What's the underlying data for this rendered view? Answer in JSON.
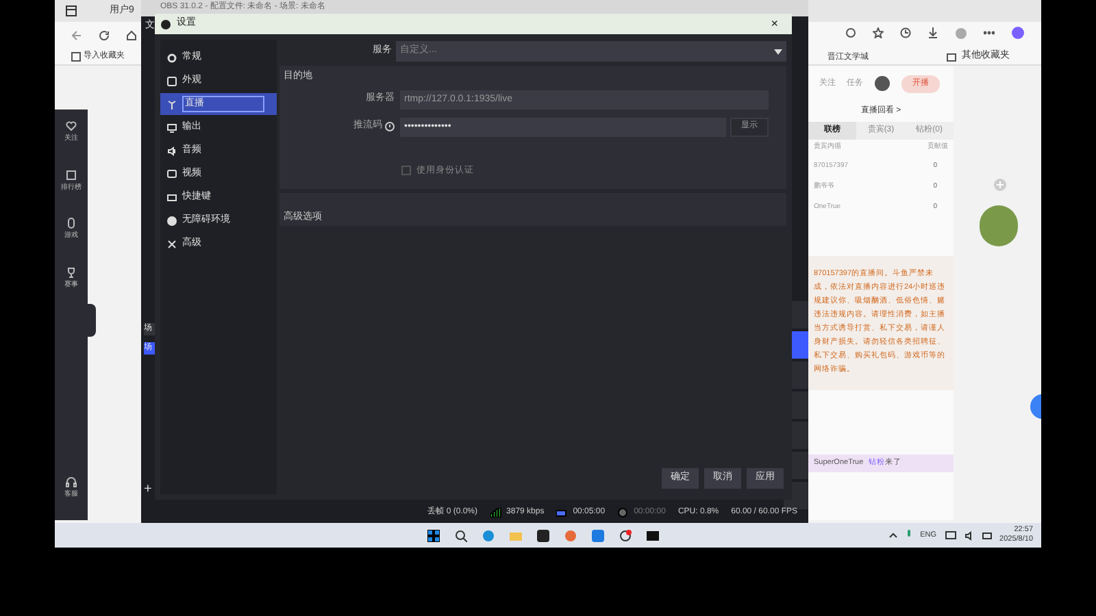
{
  "browser": {
    "tab_title": "用户9",
    "bookmarks": [
      "导入收藏夹",
      "晋江文学城",
      "其他收藏夹"
    ],
    "left_nav": [
      "关注",
      "排行榜",
      "游戏",
      "赛事",
      "客服"
    ],
    "header": {
      "follow": "关注",
      "task": "任务",
      "start_button": "开播",
      "replay": "直播回看 >"
    },
    "rank_tabs": [
      {
        "label": "联榜",
        "selected": true
      },
      {
        "label": "贵宾(3)",
        "selected": false
      },
      {
        "label": "钻粉(0)",
        "selected": false
      }
    ],
    "rank_head": {
      "name": "贵宾内循",
      "value": "贡献值"
    },
    "rank_rows": [
      {
        "name": "870157397",
        "value": "0"
      },
      {
        "name": "鹏爷爷",
        "value": "0"
      },
      {
        "name": "OneTrue",
        "value": "0"
      }
    ],
    "notice": "870157397的直播间。斗鱼严禁未成，依法对直播内容进行24小时巡违规建议你、吸烟酗酒、低俗色情、赌违法违规内容。请理性消费，如主播当方式诱导打赏、私下交易，请谨人身财产损失。请勿轻信各类招聘征、私下交易、购买礼包码、游戏币等的网络诈骗。",
    "chat_entry": {
      "user": "SuperOneTrue",
      "badge": "钻粉",
      "text": "来了"
    }
  },
  "obs": {
    "title": "OBS 31.0.2 - 配置文件: 未命名 - 场景: 未命名",
    "menu": "文",
    "add_button": "+",
    "scenes": [
      {
        "label": "场",
        "selected": false
      },
      {
        "label": "场",
        "selected": true
      }
    ],
    "status_bar": [
      "丢帧 0 (0.0%)",
      "3879 kbps",
      "00:05:00",
      "00:00:00",
      "CPU: 0.8%",
      "60.00 / 60.00 FPS"
    ]
  },
  "settings": {
    "title": "设置",
    "close": "×",
    "nav": [
      {
        "label": "常规",
        "selected": false
      },
      {
        "label": "外观",
        "selected": false
      },
      {
        "label": "直播",
        "selected": true
      },
      {
        "label": "输出",
        "selected": false
      },
      {
        "label": "音频",
        "selected": false
      },
      {
        "label": "视频",
        "selected": false
      },
      {
        "label": "快捷键",
        "selected": false
      },
      {
        "label": "无障碍环境",
        "selected": false
      },
      {
        "label": "高级",
        "selected": false
      }
    ],
    "service": {
      "label": "服务",
      "value": "自定义..."
    },
    "destination": {
      "heading": "目的地",
      "server_label": "服务器",
      "server": "rtmp://127.0.0.1:1935/live",
      "key_label": "推流码",
      "key": "••••••••••••••",
      "show_button": "显示"
    },
    "auth": {
      "label": "使用身份认证",
      "checked": false
    },
    "advanced": "高级选项",
    "buttons": [
      "确定",
      "取消",
      "应用"
    ]
  },
  "taskbar": {
    "lang": "ENG",
    "time": "22:57",
    "date": "2025/8/10"
  }
}
